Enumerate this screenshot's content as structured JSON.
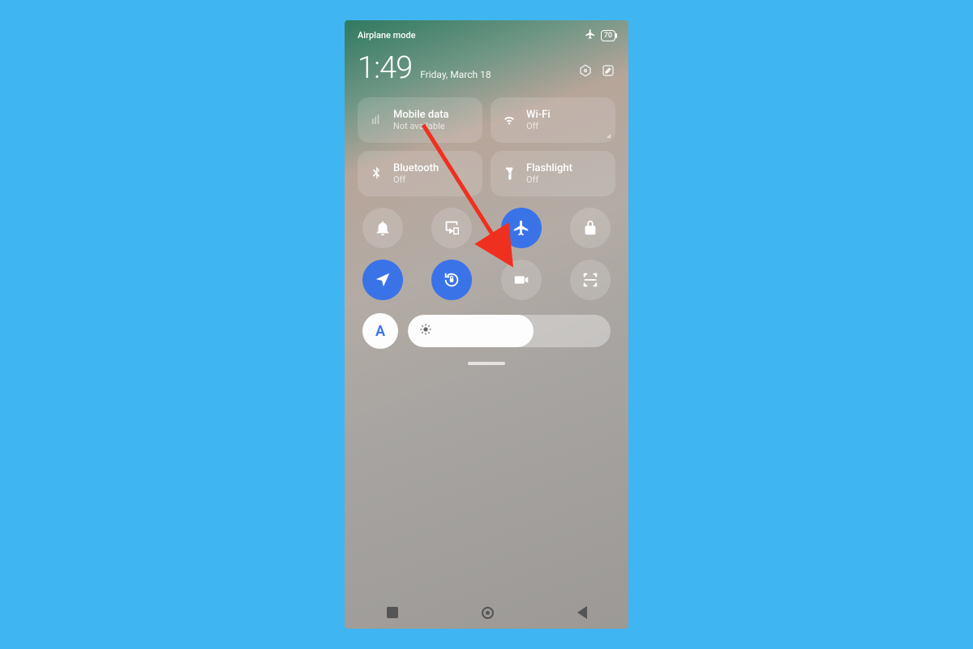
{
  "statusbar": {
    "label": "Airplane mode",
    "battery": "70"
  },
  "clock": {
    "time": "1:49",
    "date": "Friday, March 18"
  },
  "tiles": {
    "mobile": {
      "title": "Mobile data",
      "sub": "Not available"
    },
    "wifi": {
      "title": "Wi-Fi",
      "sub": "Off"
    },
    "bluetooth": {
      "title": "Bluetooth",
      "sub": "Off"
    },
    "flashlight": {
      "title": "Flashlight",
      "sub": "Off"
    }
  },
  "brightness": {
    "auto_label": "A",
    "percent": 62
  },
  "colors": {
    "accent": "#3a73e8",
    "arrow": "#f0301e"
  },
  "round_toggles": [
    {
      "name": "bell",
      "active": false
    },
    {
      "name": "cast",
      "active": false
    },
    {
      "name": "airplane",
      "active": true
    },
    {
      "name": "lock",
      "active": false
    },
    {
      "name": "location",
      "active": true
    },
    {
      "name": "rotation-lock",
      "active": true
    },
    {
      "name": "screen-record",
      "active": false
    },
    {
      "name": "scan",
      "active": false
    }
  ]
}
